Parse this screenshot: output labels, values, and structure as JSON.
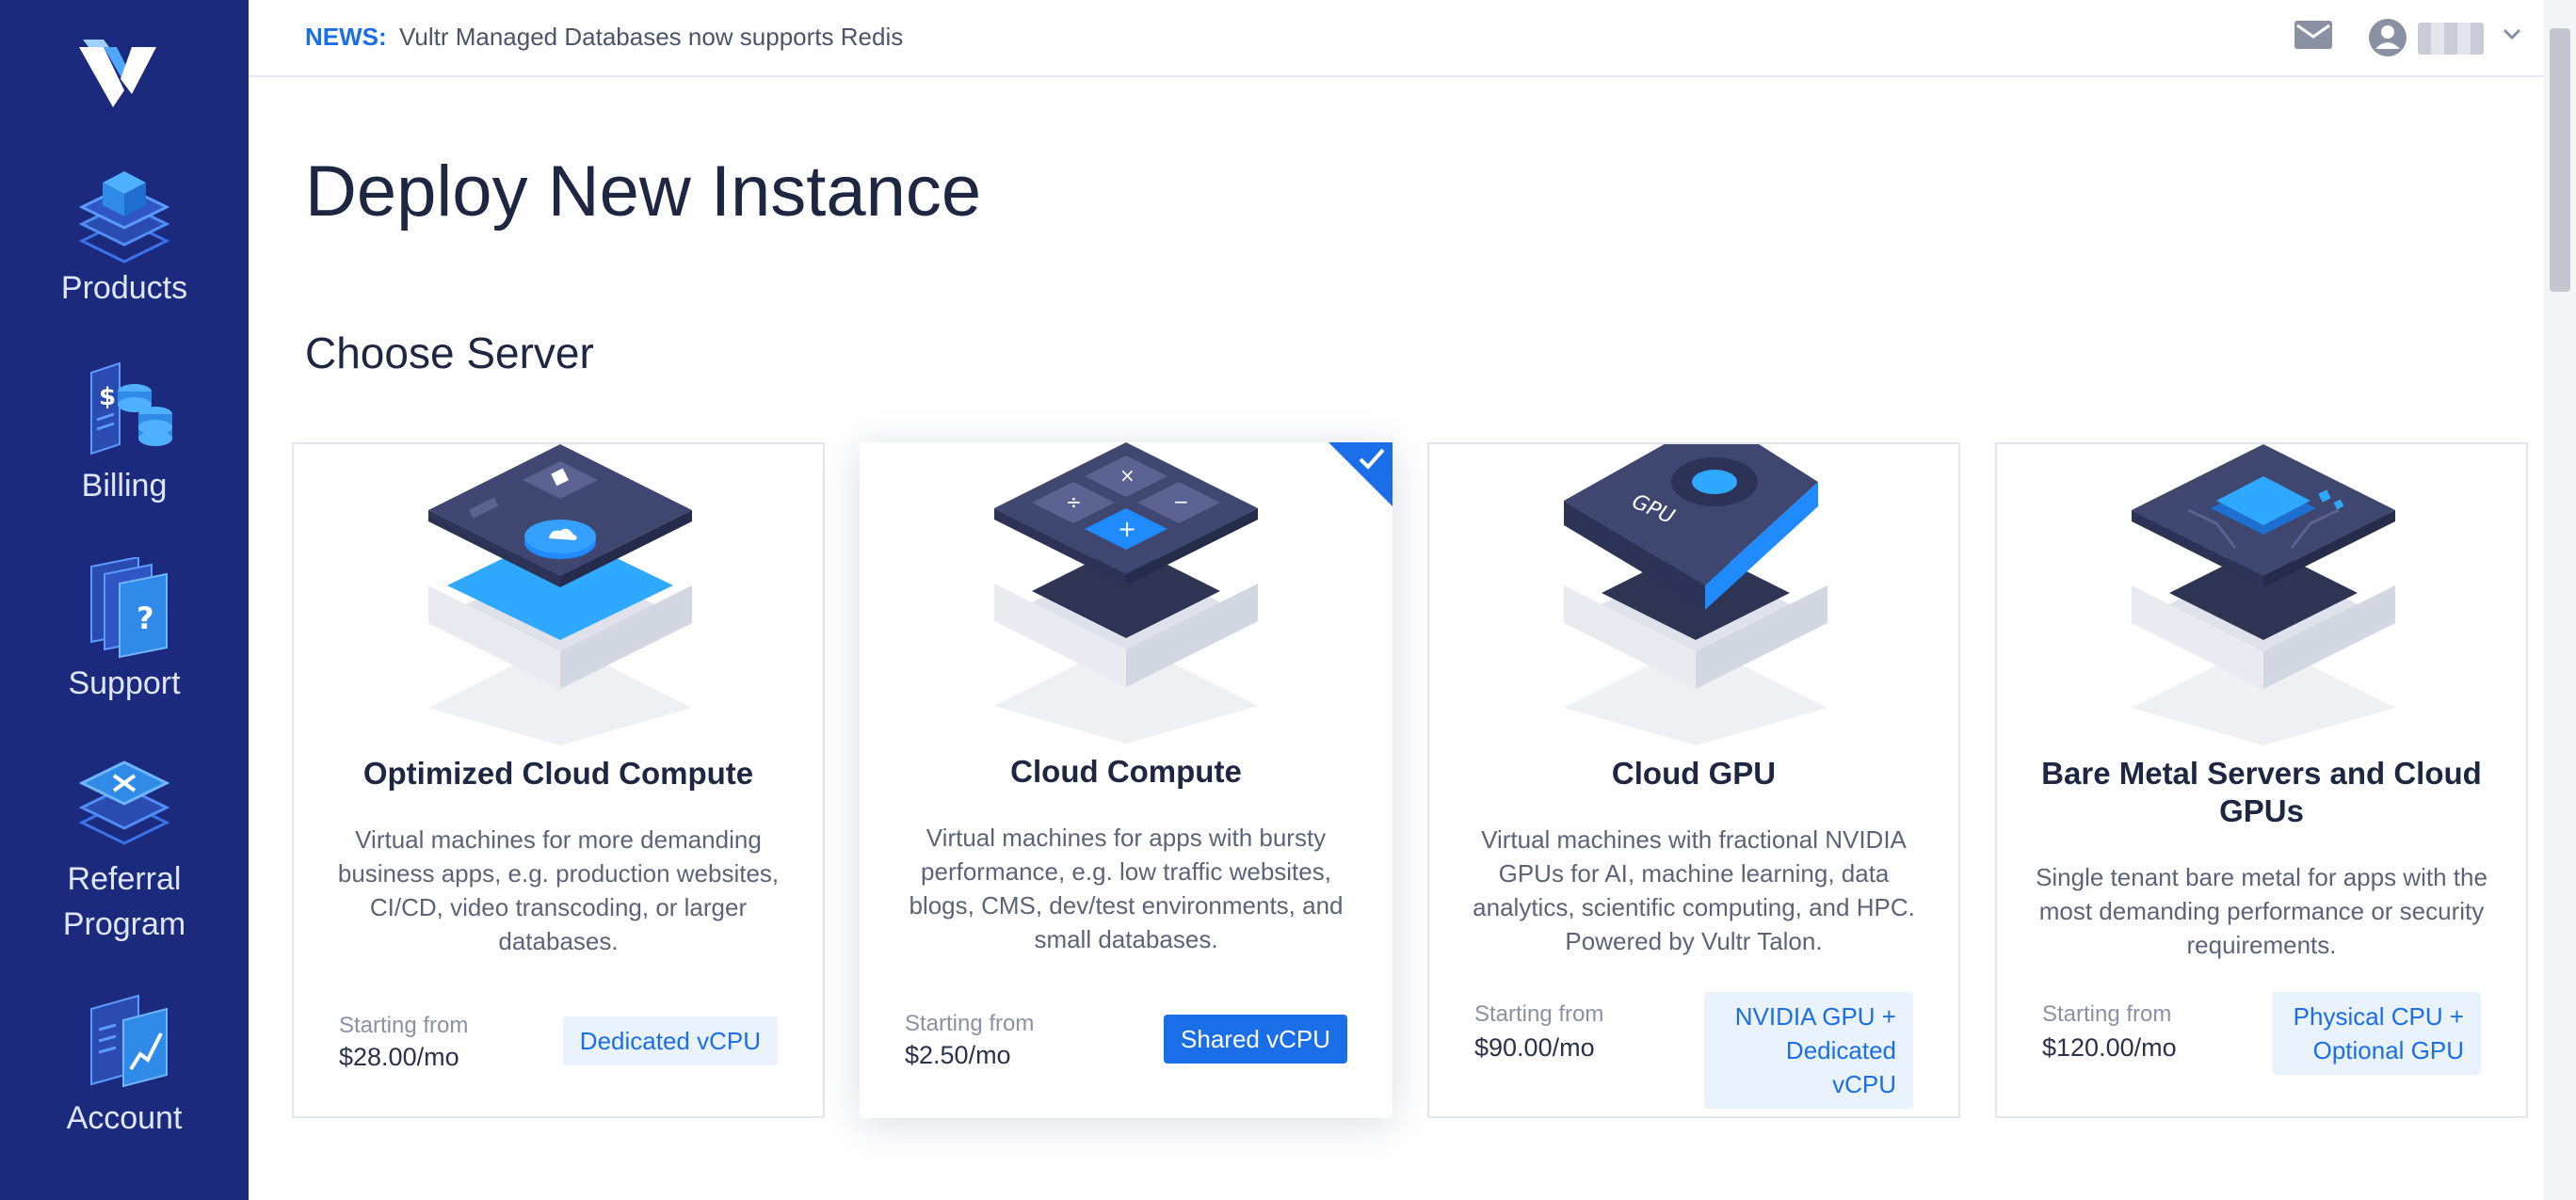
{
  "sidebar": {
    "items": [
      {
        "label": "Products"
      },
      {
        "label": "Billing"
      },
      {
        "label": "Support"
      },
      {
        "label": "Referral Program"
      },
      {
        "label": "Account"
      }
    ]
  },
  "header": {
    "news_label": "NEWS:",
    "news_text": "Vultr Managed Databases now supports Redis"
  },
  "main": {
    "page_title": "Deploy New Instance",
    "section_title": "Choose Server",
    "cards": [
      {
        "title": "Optimized Cloud Compute",
        "description": "Virtual machines for more demanding business apps, e.g. production websites, CI/CD, video transcoding, or larger databases.",
        "starting_label": "Starting from",
        "price": "$28.00/mo",
        "badge": "Dedicated vCPU",
        "selected": false
      },
      {
        "title": "Cloud Compute",
        "description": "Virtual machines for apps with bursty performance, e.g. low traffic websites, blogs, CMS, dev/test environments, and small databases.",
        "starting_label": "Starting from",
        "price": "$2.50/mo",
        "badge": "Shared vCPU",
        "selected": true
      },
      {
        "title": "Cloud GPU",
        "description": "Virtual machines with fractional NVIDIA GPUs for AI, machine learning, data analytics, scientific computing, and HPC. Powered by Vultr Talon.",
        "starting_label": "Starting from",
        "price": "$90.00/mo",
        "badge": "NVIDIA GPU + Dedicated vCPU",
        "selected": false
      },
      {
        "title": "Bare Metal Servers and Cloud GPUs",
        "description": "Single tenant bare metal for apps with the most demanding performance or security requirements.",
        "starting_label": "Starting from",
        "price": "$120.00/mo",
        "badge": "Physical CPU + Optional GPU",
        "selected": false
      }
    ]
  },
  "colors": {
    "sidebar_bg": "#1b2a7c",
    "accent": "#1a6fe8"
  },
  "icons": [
    "vultr-logo",
    "products-icon",
    "billing-icon",
    "support-icon",
    "referral-icon",
    "account-icon",
    "mail-icon",
    "user-icon",
    "chevron-down-icon",
    "checkmark-icon"
  ]
}
